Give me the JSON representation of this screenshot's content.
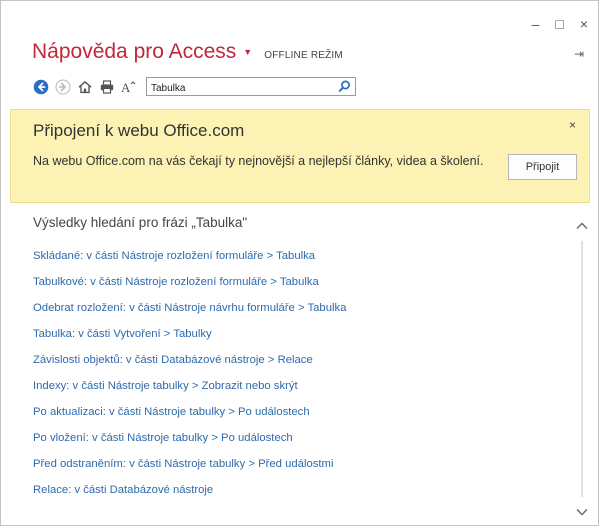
{
  "window": {
    "controls": {
      "minimize": "–",
      "maximize": "□",
      "close": "×"
    },
    "pin_glyph": "⇥"
  },
  "header": {
    "title": "Nápověda pro Access",
    "title_dropdown": "▼",
    "offline_label": "OFFLINE REŽIM"
  },
  "toolbar": {
    "icons": [
      "back-icon",
      "forward-icon",
      "home-icon",
      "print-icon",
      "text-size-icon",
      "search-icon"
    ],
    "text_size_label": "A",
    "search_value": "Tabulka",
    "search_placeholder": ""
  },
  "banner": {
    "title": "Připojení k webu Office.com",
    "text": "Na webu Office.com na vás čekají ty nejnovější a nejlepší články, videa a školení.",
    "close_glyph": "×",
    "connect_label": "Připojit",
    "background_color": "#fbf2b4"
  },
  "results": {
    "heading": "Výsledky hledání pro frázi „Tabulka\"",
    "items": [
      "Skládané: v části Nástroje rozložení formuláře > Tabulka",
      "Tabulkové: v části Nástroje rozložení formuláře > Tabulka",
      "Odebrat rozložení: v části Nástroje návrhu formuláře > Tabulka",
      "Tabulka: v části Vytvoření > Tabulky",
      "Závislosti objektů: v části Databázové nástroje > Relace",
      "Indexy: v části Nástroje tabulky > Zobrazit nebo skrýt",
      "Po aktualizaci: v části Nástroje tabulky > Po událostech",
      "Po vložení: v části Nástroje tabulky > Po událostech",
      "Před odstraněním: v části Nástroje tabulky > Před událostmi",
      "Relace: v části Databázové nástroje"
    ],
    "link_color": "#2f6aab"
  },
  "colors": {
    "title": "#c0283b",
    "nav_blue": "#2b6cc4",
    "banner": "#fbf2b4"
  }
}
